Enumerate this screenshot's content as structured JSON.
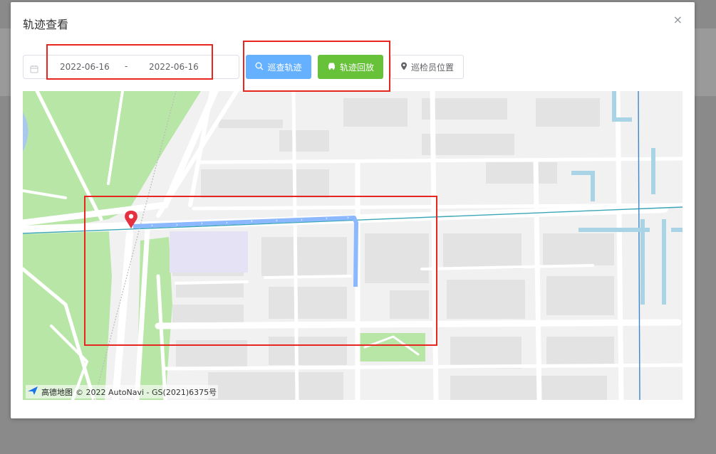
{
  "dialog": {
    "title": "轨迹查看",
    "close_symbol": "×"
  },
  "date_range": {
    "start": "2022-06-16",
    "separator": "-",
    "end": "2022-06-16",
    "icon": "calendar-icon"
  },
  "buttons": {
    "search_track": "巡查轨迹",
    "playback_track": "轨迹回放",
    "inspector_position": "巡检员位置"
  },
  "map": {
    "logo_text": "高德地图",
    "copyright": "© 2022 AutoNavi - GS(2021)6375号",
    "marker_icon": "map-pin-icon",
    "colors": {
      "park": "#b7e6a7",
      "road": "#ffffff",
      "block": "#f1f1f1",
      "building": "#e3e3e3",
      "water": "#a8d4e6",
      "track": "#8cb8ff",
      "highlight": "#e6261f",
      "marker": "#e4303f"
    }
  },
  "colors": {
    "primary_light": "#66b1ff",
    "success": "#67c23a",
    "mask": "#8a8a8a"
  }
}
